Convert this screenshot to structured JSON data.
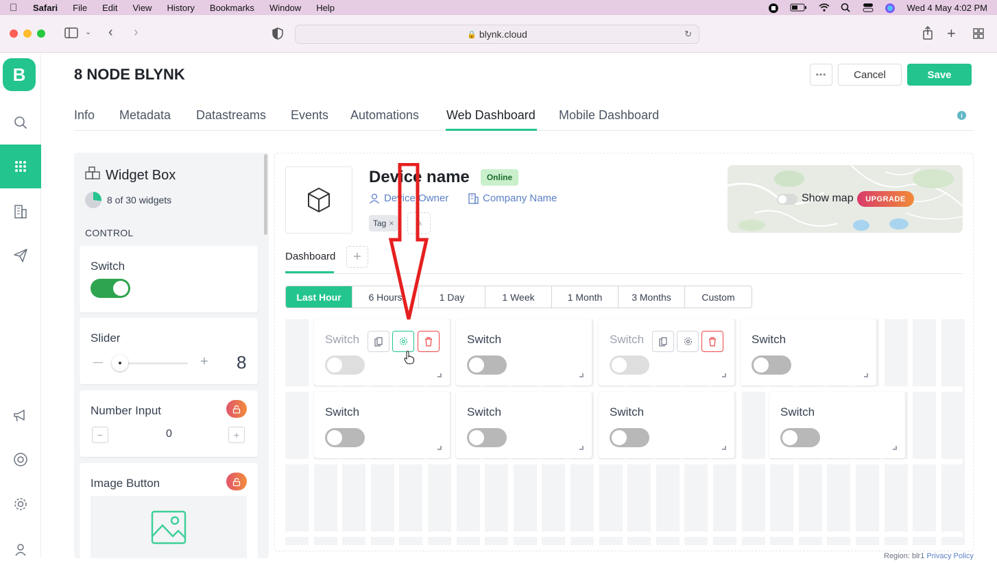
{
  "menubar": {
    "app": "Safari",
    "items": [
      "File",
      "Edit",
      "View",
      "History",
      "Bookmarks",
      "Window",
      "Help"
    ],
    "clock": "Wed 4 May  4:02 PM"
  },
  "browser": {
    "url": "blynk.cloud"
  },
  "sidebar": {
    "logo": "B",
    "icons": [
      "search-icon",
      "dashboard-grid-icon",
      "building-icon",
      "send-icon",
      "megaphone-icon",
      "lifebuoy-icon",
      "gear-icon",
      "user-icon"
    ]
  },
  "header": {
    "title": "8 NODE BLYNK",
    "more_label": "•••",
    "cancel_label": "Cancel",
    "save_label": "Save"
  },
  "tabs": [
    "Info",
    "Metadata",
    "Datastreams",
    "Events",
    "Automations",
    "Web Dashboard",
    "Mobile Dashboard"
  ],
  "active_tab": "Web Dashboard",
  "info_icon": "i",
  "widget_box": {
    "title": "Widget Box",
    "count": "8 of 30 widgets",
    "count_fraction": 0.27,
    "section": "CONTROL",
    "widgets": [
      {
        "name": "Switch"
      },
      {
        "name": "Slider",
        "minus": "—",
        "plus": "+",
        "value": "8"
      },
      {
        "name": "Number Input",
        "minus": "−",
        "plus": "+",
        "value": "0"
      },
      {
        "name": "Image Button"
      }
    ]
  },
  "device": {
    "name": "Device name",
    "status": "Online",
    "owner": "Device Owner",
    "company": "Company Name",
    "tag": "Tag",
    "tag_close": "×"
  },
  "map": {
    "label": "Show map",
    "badge": "UPGRADE"
  },
  "dashboard": {
    "tab": "Dashboard",
    "add": "+",
    "ranges": [
      "Last Hour",
      "6 Hours",
      "1 Day",
      "1 Week",
      "1 Month",
      "3 Months",
      "Custom"
    ],
    "selected_range": "Last Hour"
  },
  "switch_widgets": [
    {
      "name": "Switch",
      "state": "off",
      "selected": true
    },
    {
      "name": "Switch",
      "state": "off",
      "selected": false
    },
    {
      "name": "Switch",
      "state": "off",
      "selected": true
    },
    {
      "name": "Switch",
      "state": "off",
      "selected": false
    },
    {
      "name": "Switch",
      "state": "off",
      "selected": false
    },
    {
      "name": "Switch",
      "state": "off",
      "selected": false
    },
    {
      "name": "Switch",
      "state": "off",
      "selected": false
    },
    {
      "name": "Switch",
      "state": "off",
      "selected": false
    }
  ],
  "colors": {
    "brand": "#23c48e",
    "annotation_arrow": "#e5201f",
    "link": "#5b7fc5"
  },
  "footer": {
    "region": "Region: blr1",
    "privacy": "Privacy Policy"
  }
}
